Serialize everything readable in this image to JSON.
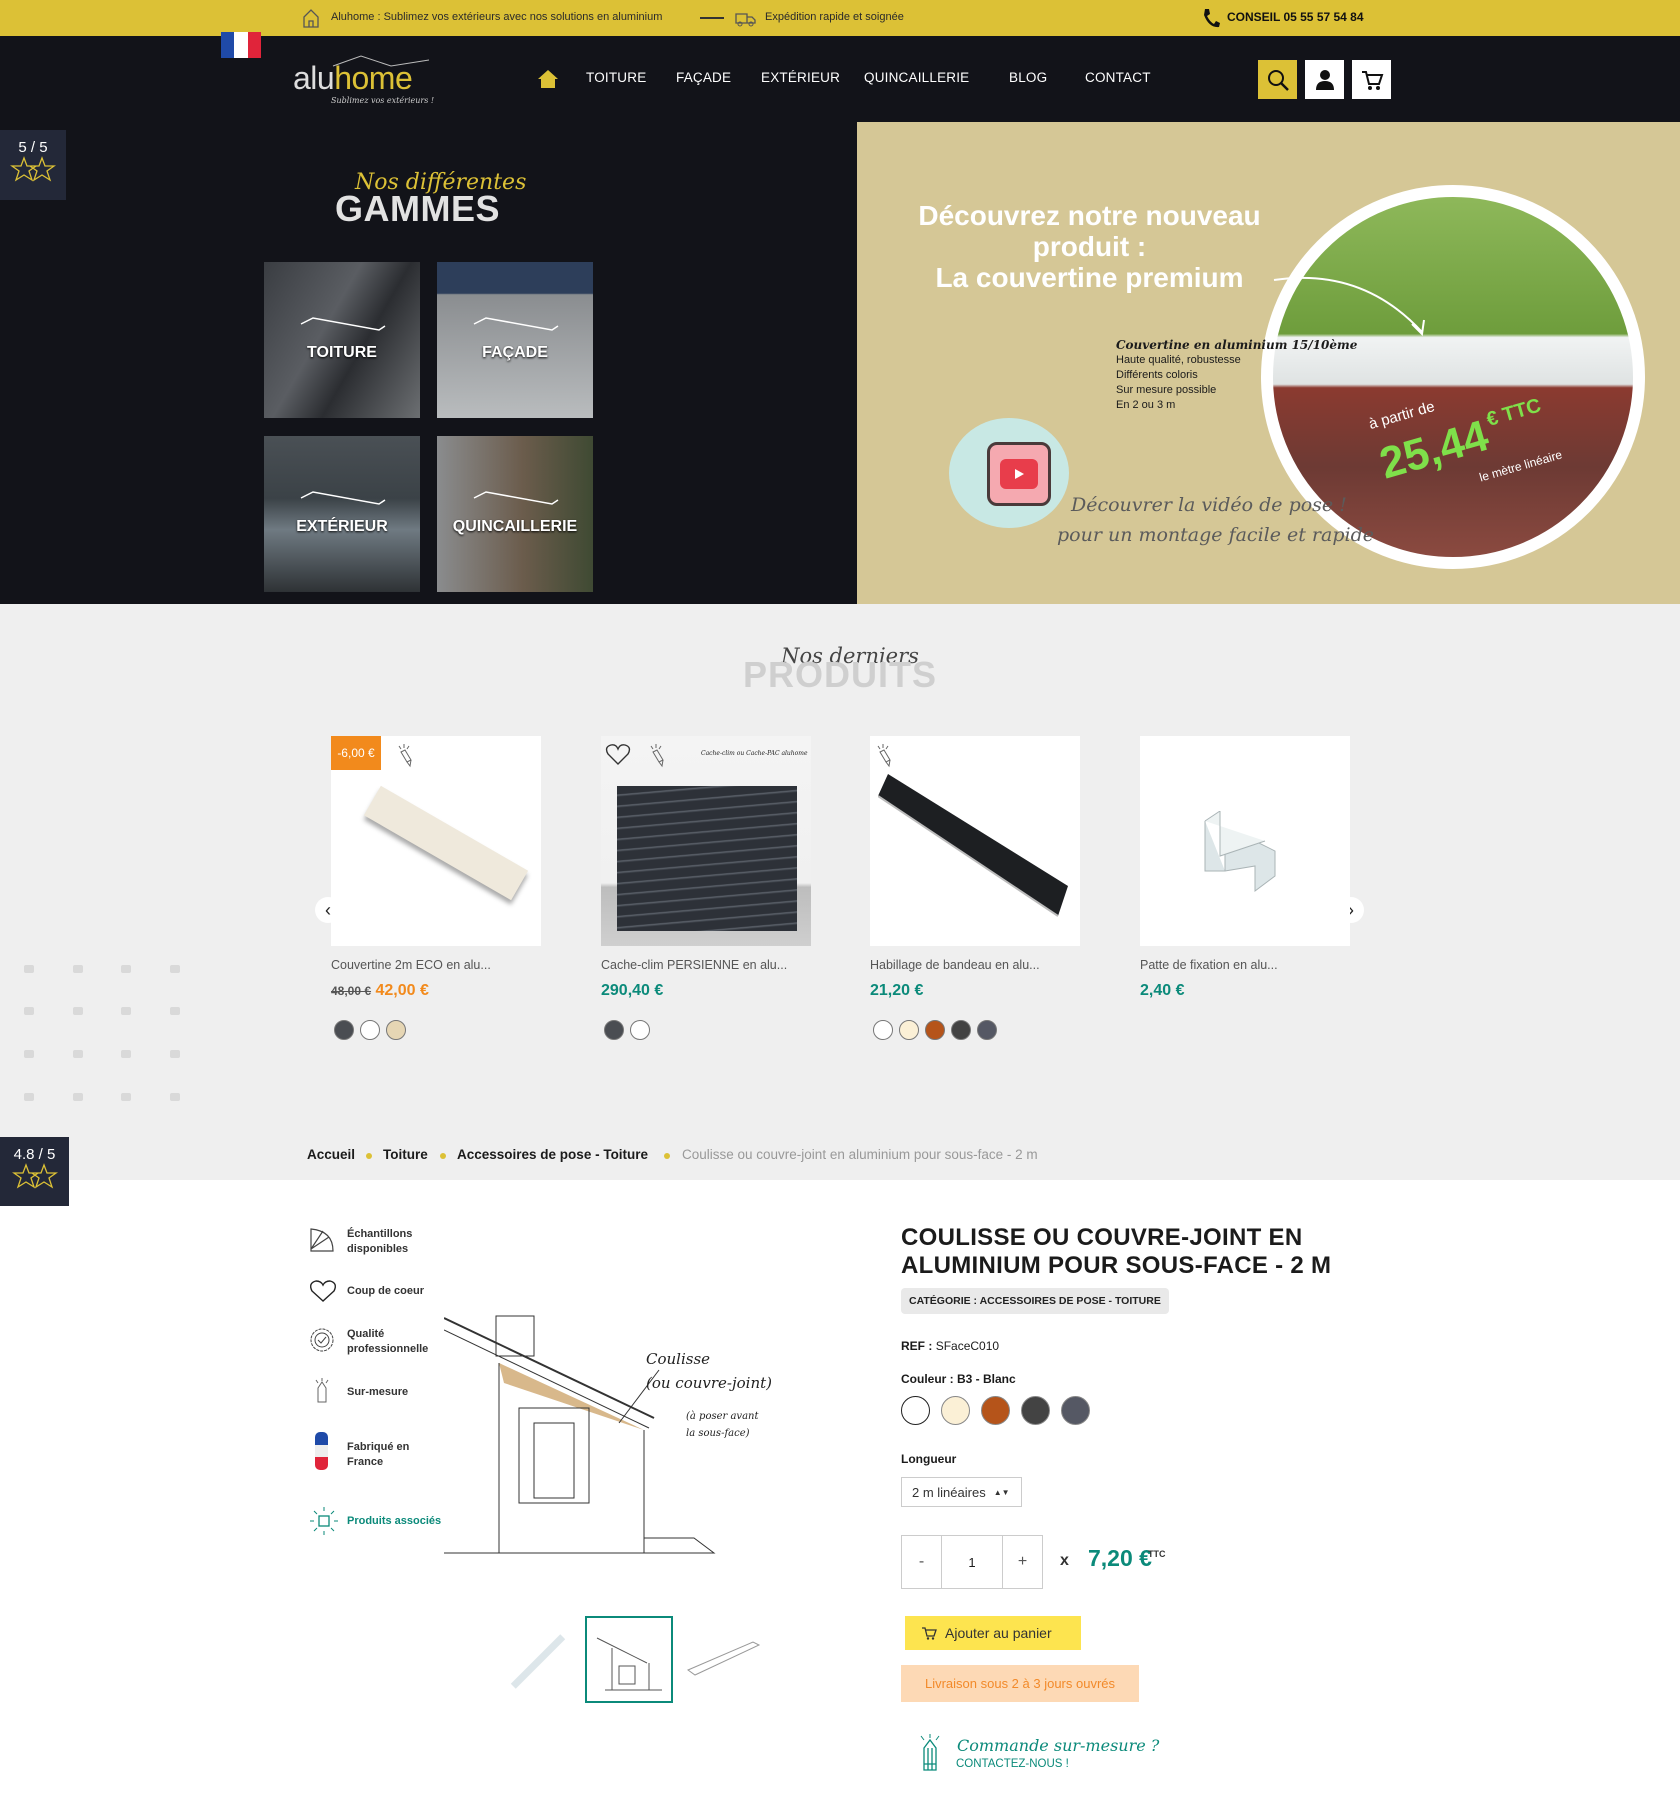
{
  "topbar": {
    "tagline": "Aluhome : Sublimez vos extérieurs avec nos solutions en aluminium",
    "shipping": "Expédition rapide et soignée",
    "phone": "CONSEIL 05 55 57 54 84",
    "language": "fr"
  },
  "header": {
    "logo_main_a": "alu",
    "logo_main_b": "home",
    "logo_tagline": "Sublimez vos extérieurs !",
    "menu": [
      "TOITURE",
      "FAÇADE",
      "EXTÉRIEUR",
      "QUINCAILLERIE",
      "BLOG",
      "CONTACT"
    ],
    "icons": [
      "home-icon",
      "search-icon",
      "user-icon",
      "cart-icon"
    ]
  },
  "ratings": [
    {
      "score": "5 / 5"
    },
    {
      "score": "4.8 / 5"
    }
  ],
  "gammes": {
    "script": "Nos différentes",
    "title": "GAMMES",
    "tiles": [
      "TOITURE",
      "FAÇADE",
      "EXTÉRIEUR",
      "QUINCAILLERIE"
    ]
  },
  "promo": {
    "headline1": "Découvrez notre nouveau",
    "headline2": "produit :",
    "headline3": "La couvertine premium",
    "spec_title": "Couvertine en aluminium 15/10ème",
    "specs": [
      "Haute qualité, robustesse",
      "Différents coloris",
      "Sur mesure possible",
      "En 2 ou 3 m"
    ],
    "from": "à partir de",
    "price": "25,44",
    "price_unit": "€ TTC",
    "per": "le mètre linéaire",
    "video1": "Découvrer la vidéo de pose !",
    "video2": "pour un montage facile et rapide"
  },
  "latest": {
    "script": "Nos derniers",
    "title": "PRODUITS",
    "products": [
      {
        "name": "Couvertine 2m ECO en alu...",
        "old_price": "48,00 €",
        "price": "42,00 €",
        "discount": "-6,00 €",
        "swatches": [
          "#4a4d52",
          "#ffffff",
          "#e6d6b4"
        ]
      },
      {
        "name": "Cache-clim PERSIENNE en alu...",
        "price": "290,40 €",
        "image_caption": "Cache-clim ou Cache-PAC aluhome",
        "swatches": [
          "#4a4d52",
          "#ffffff"
        ]
      },
      {
        "name": "Habillage de bandeau en alu...",
        "price": "21,20 €",
        "swatches": [
          "#ffffff",
          "#fbf0d6",
          "#b5541a",
          "#434343",
          "#555864"
        ]
      },
      {
        "name": "Patte de fixation en alu...",
        "price": "2,40 €",
        "swatches": []
      }
    ]
  },
  "breadcrumb": [
    "Accueil",
    "Toiture",
    "Accessoires de pose - Toiture",
    "Coulisse ou couvre-joint en aluminium pour sous-face - 2 m"
  ],
  "features": [
    "Échantillons disponibles",
    "Coup de coeur",
    "Qualité professionnelle",
    "Sur-mesure",
    "Fabriqué en France",
    "Produits associés"
  ],
  "drawing": {
    "label1": "Coulisse",
    "label2": "(ou couvre-joint)",
    "note1": "(à poser avant",
    "note2": "la sous-face)"
  },
  "product": {
    "title_line1": "COULISSE OU COUVRE-JOINT EN",
    "title_line2": "ALUMINIUM POUR SOUS-FACE - 2 M",
    "category": "CATÉGORIE : ACCESSOIRES DE POSE - TOITURE",
    "ref_label": "REF :",
    "ref": "SFaceC010",
    "color_label": "Couleur : B3 - Blanc",
    "colors": [
      "#ffffff",
      "#fbf0d6",
      "#b5541a",
      "#434343",
      "#555864"
    ],
    "length_label": "Longueur",
    "length_value": "2 m linéaires",
    "qty_minus": "-",
    "qty": "1",
    "qty_plus": "+",
    "times": "x",
    "price": "7,20 €",
    "price_suffix": "TTC",
    "add_to_cart": "Ajouter au panier",
    "delivery": "Livraison sous 2 à 3 jours ouvrés",
    "custom_title": "Commande sur-mesure ?",
    "custom_link": "CONTACTEZ-NOUS !"
  },
  "colors": {
    "yellow": "#dcc136",
    "dark": "#121319",
    "teal": "#0b8a7a",
    "orange": "#f28a1c"
  }
}
